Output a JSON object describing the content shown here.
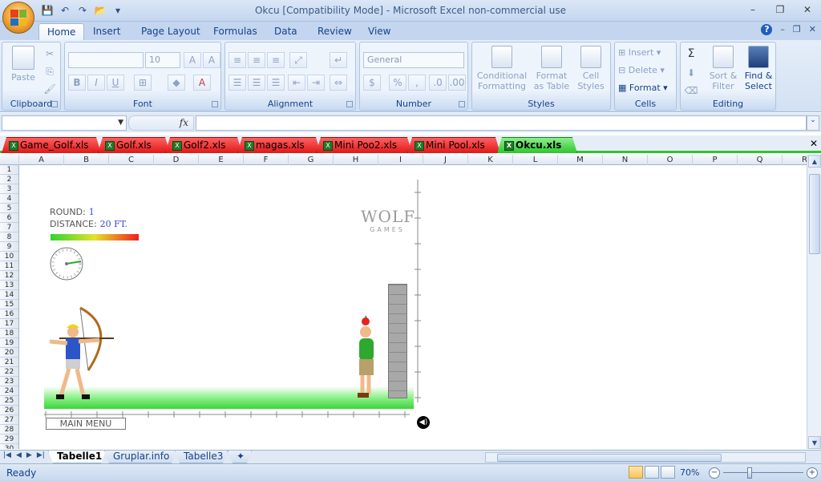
{
  "window": {
    "title": "Okcu  [Compatibility Mode] - Microsoft Excel non-commercial use",
    "controls": [
      "–",
      "❐",
      "✕"
    ]
  },
  "ribbon_tabs": [
    "Home",
    "Insert",
    "Page Layout",
    "Formulas",
    "Data",
    "Review",
    "View"
  ],
  "active_ribbon_tab": "Home",
  "ribbon": {
    "clipboard": {
      "paste": "Paste",
      "label": "Clipboard"
    },
    "font": {
      "size": "10",
      "label": "Font"
    },
    "alignment": {
      "label": "Alignment"
    },
    "number": {
      "format": "General",
      "currency": "$",
      "percent": "%",
      "comma": ",",
      "label": "Number"
    },
    "styles": {
      "conditional_1": "Conditional",
      "conditional_2": "Formatting",
      "table_1": "Format",
      "table_2": "as Table",
      "cell_1": "Cell",
      "cell_2": "Styles",
      "label": "Styles"
    },
    "cells": {
      "insert": "Insert",
      "delete": "Delete",
      "format": "Format",
      "label": "Cells"
    },
    "editing": {
      "sort_1": "Sort &",
      "sort_2": "Filter",
      "find_1": "Find &",
      "find_2": "Select",
      "label": "Editing"
    }
  },
  "formula_bar": {
    "fx": "fx",
    "name": "",
    "value": ""
  },
  "workbook_tabs": [
    {
      "label": "Game_Golf.xls",
      "active": false
    },
    {
      "label": "Golf.xls",
      "active": false
    },
    {
      "label": "Golf2.xls",
      "active": false
    },
    {
      "label": "magas.xls",
      "active": false
    },
    {
      "label": "Mini Poo2.xls",
      "active": false
    },
    {
      "label": "Mini Pool.xls",
      "active": false
    },
    {
      "label": "Okcu.xls",
      "active": true
    }
  ],
  "columns": [
    "A",
    "B",
    "C",
    "D",
    "E",
    "F",
    "G",
    "H",
    "I",
    "J",
    "K",
    "L",
    "M",
    "N",
    "O",
    "P",
    "Q",
    "R"
  ],
  "rows": [
    "1",
    "2",
    "3",
    "4",
    "5",
    "6",
    "7",
    "8",
    "9",
    "10",
    "11",
    "12",
    "13",
    "14",
    "15",
    "16",
    "17",
    "18",
    "19",
    "20",
    "21",
    "22",
    "23",
    "24",
    "25",
    "26",
    "27",
    "28",
    "29",
    "30"
  ],
  "game": {
    "round_label": "ROUND:",
    "round_value": "1",
    "distance_label": "DISTANCE:",
    "distance_value": "20 FT.",
    "logo_text": "WOLF",
    "logo_sub": "GAMES",
    "main_menu": "MAIN MENU"
  },
  "sheet_tabs": [
    {
      "label": "Tabelle1",
      "active": true
    },
    {
      "label": "Gruplar.info",
      "active": false
    },
    {
      "label": "Tabelle3",
      "active": false
    }
  ],
  "status": {
    "ready": "Ready",
    "zoom": "70%"
  }
}
